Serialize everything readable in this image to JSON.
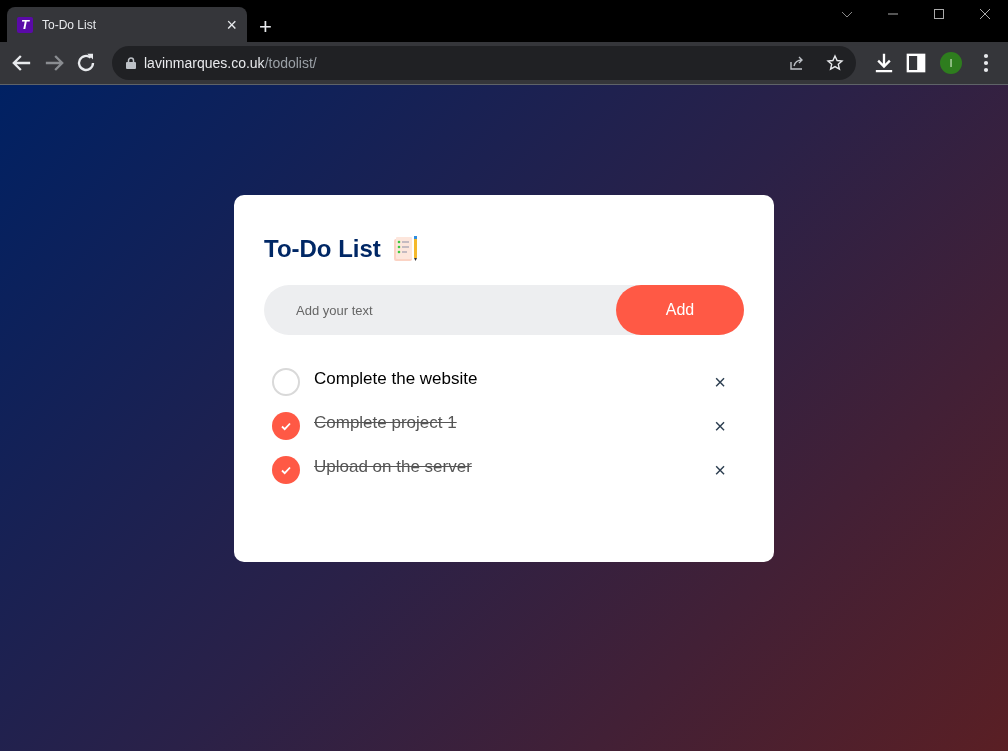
{
  "browser": {
    "tab": {
      "favicon_letter": "T",
      "title": "To-Do List",
      "close": "×",
      "new_tab": "+"
    },
    "address": {
      "domain": "lavinmarques.co.uk",
      "path": "/todolist/"
    },
    "profile_letter": "I"
  },
  "app": {
    "title": "To-Do List",
    "input": {
      "placeholder": "Add your text"
    },
    "add_button": "Add",
    "tasks": [
      {
        "text": "Complete the website",
        "checked": false,
        "delete": "×"
      },
      {
        "text": "Complete project 1",
        "checked": true,
        "delete": "×"
      },
      {
        "text": "Upload on the server",
        "checked": true,
        "delete": "×"
      }
    ]
  }
}
